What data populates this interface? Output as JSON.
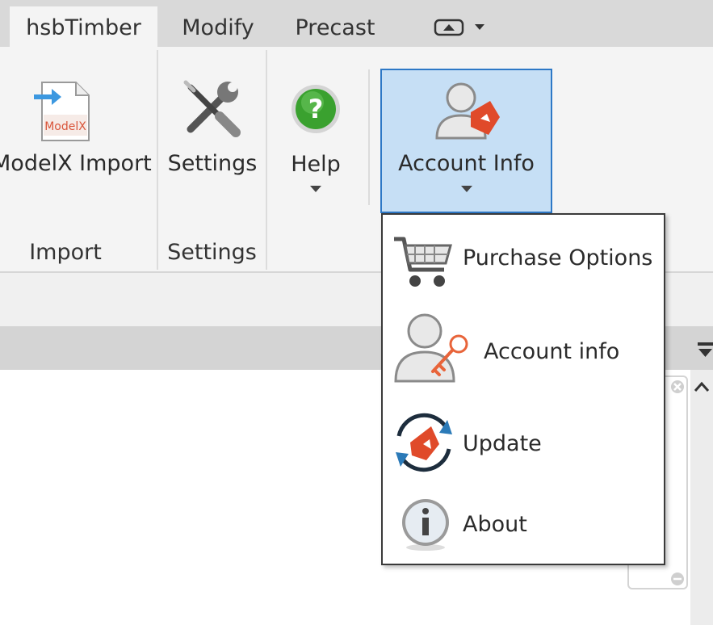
{
  "tabs": [
    {
      "label": "hsbTimber",
      "active": true
    },
    {
      "label": "Modify",
      "active": false
    },
    {
      "label": "Precast",
      "active": false
    }
  ],
  "ribbon": {
    "modelx_import": {
      "label": "ModelX Import",
      "icon": "modelx-file-icon",
      "icon_text": "ModelX"
    },
    "settings": {
      "label": "Settings",
      "icon": "wrench-screwdriver-icon"
    },
    "help": {
      "label": "Help",
      "icon": "help-icon",
      "glyph": "?"
    },
    "account_info": {
      "label": "Account Info",
      "icon": "account-user-icon"
    },
    "groups": {
      "import": "Import",
      "settings": "Settings"
    }
  },
  "menu": {
    "items": [
      {
        "label": "Purchase Options",
        "icon": "cart-icon"
      },
      {
        "label": "Account  info",
        "icon": "user-key-icon"
      },
      {
        "label": "Update",
        "icon": "update-icon"
      },
      {
        "label": "About",
        "icon": "info-icon"
      }
    ]
  },
  "colors": {
    "accent_blue": "#2d78c6",
    "selected_bg": "#c6dff5",
    "brand_red": "#e04a2a",
    "help_green": "#3aa12f"
  }
}
